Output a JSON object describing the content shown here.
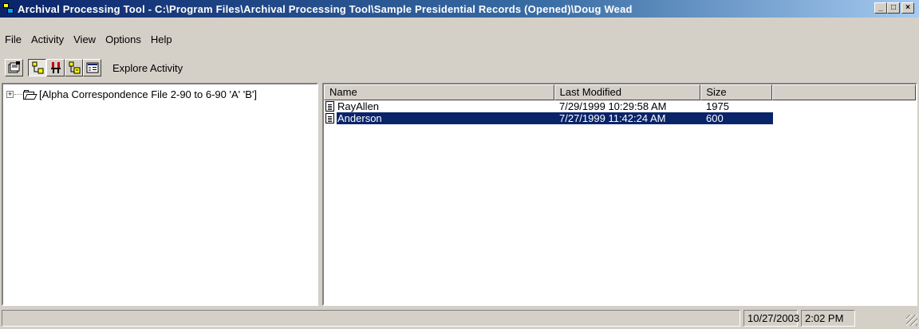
{
  "window": {
    "title": "Archival Processing Tool - C:\\Program Files\\Archival Processing Tool\\Sample Presidential Records (Opened)\\Doug Wead",
    "controls": {
      "minimize": "_",
      "maximize": "□",
      "close": "×"
    }
  },
  "menu": {
    "file": "File",
    "activity": "Activity",
    "view": "View",
    "options": "Options",
    "help": "Help"
  },
  "toolbar": {
    "label": "Explore Activity",
    "icons": [
      "properties-icon",
      "explore-icon",
      "tools-icon",
      "archive-icon",
      "details-icon"
    ]
  },
  "tree": {
    "expander": "+",
    "root_label": "[Alpha Correspondence File 2-90 to 6-90 'A'  'B']"
  },
  "list": {
    "columns": {
      "name": "Name",
      "modified": "Last Modified",
      "size": "Size"
    },
    "rows": [
      {
        "name": "RayAllen",
        "modified": "7/29/1999 10:29:58 AM",
        "size": "1975",
        "selected": false
      },
      {
        "name": "Anderson",
        "modified": "7/27/1999 11:42:24 AM",
        "size": "600",
        "selected": true
      }
    ]
  },
  "status": {
    "message": "",
    "date": "10/27/2003",
    "time": "2:02 PM"
  },
  "colors": {
    "title_active": "#0a246a",
    "face": "#d4d0c8",
    "selection": "#0a246a"
  }
}
